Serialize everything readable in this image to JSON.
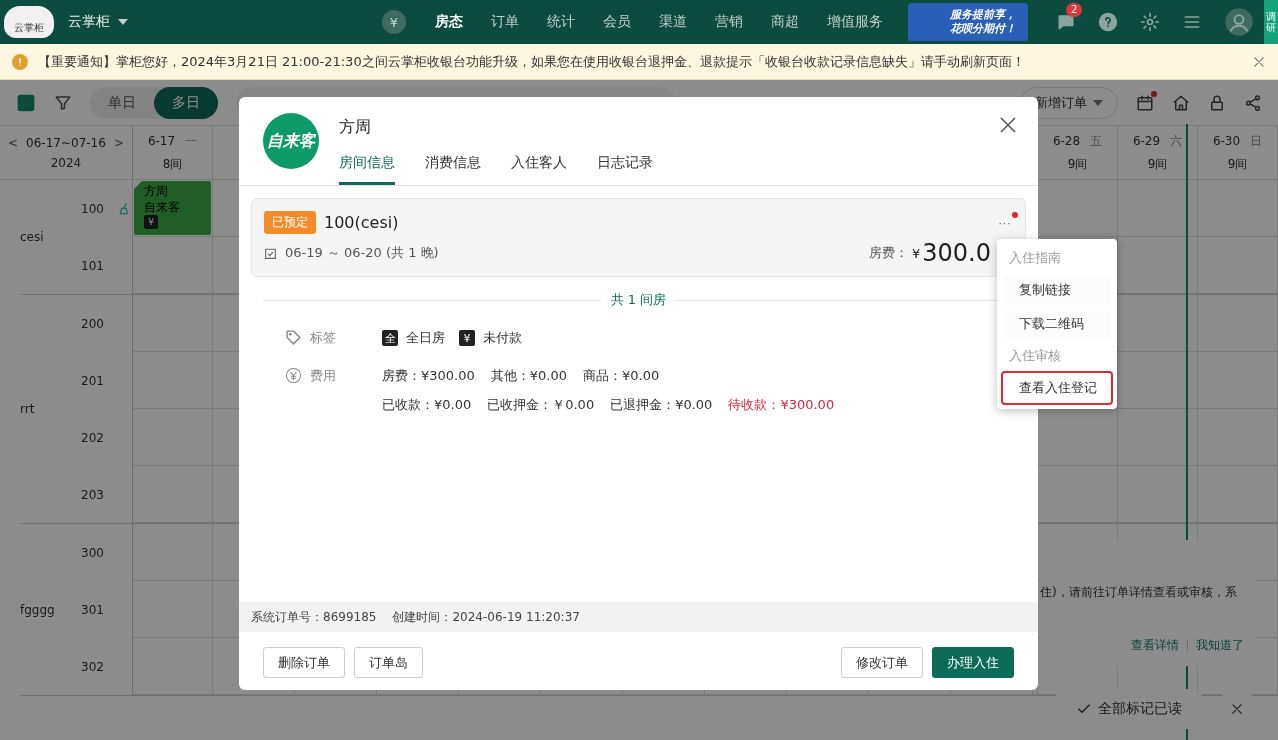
{
  "header": {
    "logo_text": "云掌柜",
    "store": "云掌柜",
    "currency_badge": "¥",
    "nav": [
      {
        "label": "房态",
        "selected": true
      },
      {
        "label": "订单",
        "selected": false
      },
      {
        "label": "统计",
        "selected": false
      },
      {
        "label": "会员",
        "selected": false
      },
      {
        "label": "渠道",
        "selected": false
      },
      {
        "label": "营销",
        "selected": false
      },
      {
        "label": "商超",
        "selected": false
      },
      {
        "label": "增值服务",
        "selected": false
      }
    ],
    "banner": [
      "服务提前享，",
      "花呗分期付！"
    ],
    "message_count": "2",
    "survey": "调研"
  },
  "notice": {
    "text": "【重要通知】掌柜您好，2024年3月21日 21:00-21:30之间云掌柜收银台功能升级，如果您在使用收银台退押金、退款提示「收银台收款记录信息缺失」请手动刷新页面！"
  },
  "toolbar": {
    "modes": [
      {
        "label": "单日",
        "selected": false
      },
      {
        "label": "多日",
        "selected": true
      }
    ],
    "new_order": "新增订单",
    "calendar_alert": true
  },
  "date_range": {
    "range": "06-17~07-16",
    "year": "2024",
    "prev": "<",
    "next": ">"
  },
  "days_left": [
    {
      "date": "6-17",
      "weekday": "一",
      "count": "8间"
    }
  ],
  "days_right": [
    {
      "date": "6-28",
      "weekday": "五",
      "count": "9间"
    },
    {
      "date": "6-29",
      "weekday": "六",
      "count": "9间"
    },
    {
      "date": "6-30",
      "weekday": "日",
      "count": "9间"
    }
  ],
  "room_groups": [
    {
      "name": "cesi",
      "rooms": [
        {
          "number": "100",
          "needs_cleaning": true,
          "booking": {
            "guest": "方周",
            "source": "自来客",
            "mark": "¥"
          }
        },
        {
          "number": "101",
          "needs_cleaning": false
        }
      ]
    },
    {
      "name": "rrt",
      "rooms": [
        {
          "number": "200",
          "needs_cleaning": false
        },
        {
          "number": "201",
          "needs_cleaning": false
        },
        {
          "number": "202",
          "needs_cleaning": false
        },
        {
          "number": "203",
          "needs_cleaning": false
        }
      ]
    },
    {
      "name": "fgggg",
      "rooms": [
        {
          "number": "300",
          "needs_cleaning": false
        },
        {
          "number": "301",
          "needs_cleaning": false
        },
        {
          "number": "302",
          "needs_cleaning": false
        }
      ]
    }
  ],
  "toast": {
    "text": "住)，请前往订单详情查看或审核，系",
    "actions": [
      "查看详情",
      "我知道了"
    ],
    "mark_all": "全部标记已读"
  },
  "order_dialog": {
    "avatar": "自来客",
    "guest": "方周",
    "tabs": [
      {
        "label": "房间信息",
        "selected": true
      },
      {
        "label": "消费信息",
        "selected": false
      },
      {
        "label": "入住客人",
        "selected": false
      },
      {
        "label": "日志记录",
        "selected": false
      }
    ],
    "room": {
      "status": "已预定",
      "name": "100(cesi)",
      "dates": "06-19 ～ 06-20 (共 1 晚)",
      "price_label": "房费：",
      "currency": "¥",
      "price": "300.0",
      "more": "···",
      "more_alert": true
    },
    "room_count": "共 1 间房",
    "tags_label": "标签",
    "tags": [
      {
        "badge": "全",
        "label": "全日房"
      },
      {
        "badge": "¥",
        "label": "未付款"
      }
    ],
    "fees_label": "费用",
    "fee_lines": [
      [
        {
          "text": "房费：¥300.00",
          "kind": "normal"
        },
        {
          "text": "其他：¥0.00",
          "kind": "normal"
        },
        {
          "text": "商品：¥0.00",
          "kind": "normal"
        }
      ],
      [
        {
          "text": "已收款：¥0.00",
          "kind": "normal"
        },
        {
          "text": "已收押金：￥0.00",
          "kind": "normal"
        },
        {
          "text": "已退押金：¥0.00",
          "kind": "normal"
        },
        {
          "text": "待收款：¥300.00",
          "kind": "due"
        }
      ]
    ],
    "order_no": "系统订单号：8699185",
    "created": "创建时间：2024-06-19 11:20:37",
    "left_buttons": [
      "删除订单",
      "订单岛"
    ],
    "right_buttons": [
      {
        "label": "修改订单",
        "kind": "default"
      },
      {
        "label": "办理入住",
        "kind": "primary"
      }
    ]
  },
  "more_menu": [
    {
      "label": "入住指南",
      "kind": "header"
    },
    {
      "label": "复制链接",
      "kind": "item",
      "highlighted": false
    },
    {
      "label": "下载二维码",
      "kind": "item",
      "highlighted": false
    },
    {
      "label": "入住审核",
      "kind": "header"
    },
    {
      "label": "查看入住登记",
      "kind": "item",
      "highlighted": true
    }
  ]
}
